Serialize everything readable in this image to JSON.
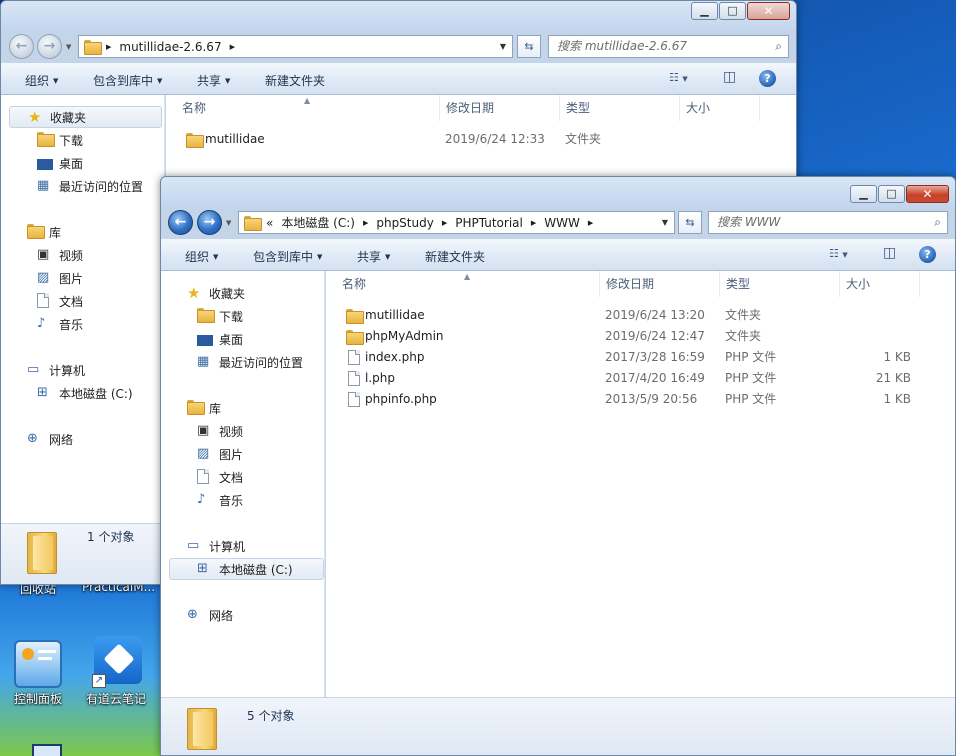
{
  "desktop": {
    "icons": [
      {
        "label": "回收站"
      },
      {
        "label": "PracticalM..."
      },
      {
        "label": "控制面板"
      },
      {
        "label": "有道云笔记"
      }
    ]
  },
  "back_window": {
    "address": {
      "crumbs": [
        "mutillidae-2.6.67"
      ]
    },
    "search_placeholder": "搜索 mutillidae-2.6.67",
    "toolbar": {
      "organize": "组织",
      "include_library": "包含到库中",
      "share": "共享",
      "new_folder": "新建文件夹"
    },
    "nav": {
      "favorites": "收藏夹",
      "downloads": "下载",
      "desktop": "桌面",
      "recent": "最近访问的位置",
      "libraries": "库",
      "videos": "视频",
      "pictures": "图片",
      "documents": "文档",
      "music": "音乐",
      "computer": "计算机",
      "local_disk": "本地磁盘 (C:)",
      "network": "网络"
    },
    "columns": {
      "name": "名称",
      "date": "修改日期",
      "type": "类型",
      "size": "大小"
    },
    "rows": [
      {
        "name": "mutillidae",
        "date": "2019/6/24 12:33",
        "type": "文件夹",
        "size": ""
      }
    ],
    "status": "1 个对象"
  },
  "front_window": {
    "address": {
      "crumbs": [
        "«",
        "本地磁盘 (C:)",
        "phpStudy",
        "PHPTutorial",
        "WWW"
      ]
    },
    "search_placeholder": "搜索 WWW",
    "toolbar": {
      "organize": "组织",
      "include_library": "包含到库中",
      "share": "共享",
      "new_folder": "新建文件夹"
    },
    "nav": {
      "favorites": "收藏夹",
      "downloads": "下载",
      "desktop": "桌面",
      "recent": "最近访问的位置",
      "libraries": "库",
      "videos": "视频",
      "pictures": "图片",
      "documents": "文档",
      "music": "音乐",
      "computer": "计算机",
      "local_disk": "本地磁盘 (C:)",
      "network": "网络"
    },
    "columns": {
      "name": "名称",
      "date": "修改日期",
      "type": "类型",
      "size": "大小"
    },
    "rows": [
      {
        "name": "mutillidae",
        "date": "2019/6/24 13:20",
        "type": "文件夹",
        "size": "",
        "icon": "folder-icon"
      },
      {
        "name": "phpMyAdmin",
        "date": "2019/6/24 12:47",
        "type": "文件夹",
        "size": "",
        "icon": "folder-icon"
      },
      {
        "name": "index.php",
        "date": "2017/3/28 16:59",
        "type": "PHP 文件",
        "size": "1 KB",
        "icon": "php-file-icon"
      },
      {
        "name": "l.php",
        "date": "2017/4/20 16:49",
        "type": "PHP 文件",
        "size": "21 KB",
        "icon": "php-file-icon"
      },
      {
        "name": "phpinfo.php",
        "date": "2013/5/9 20:56",
        "type": "PHP 文件",
        "size": "1 KB",
        "icon": "php-file-icon"
      }
    ],
    "status": "5 个对象"
  }
}
